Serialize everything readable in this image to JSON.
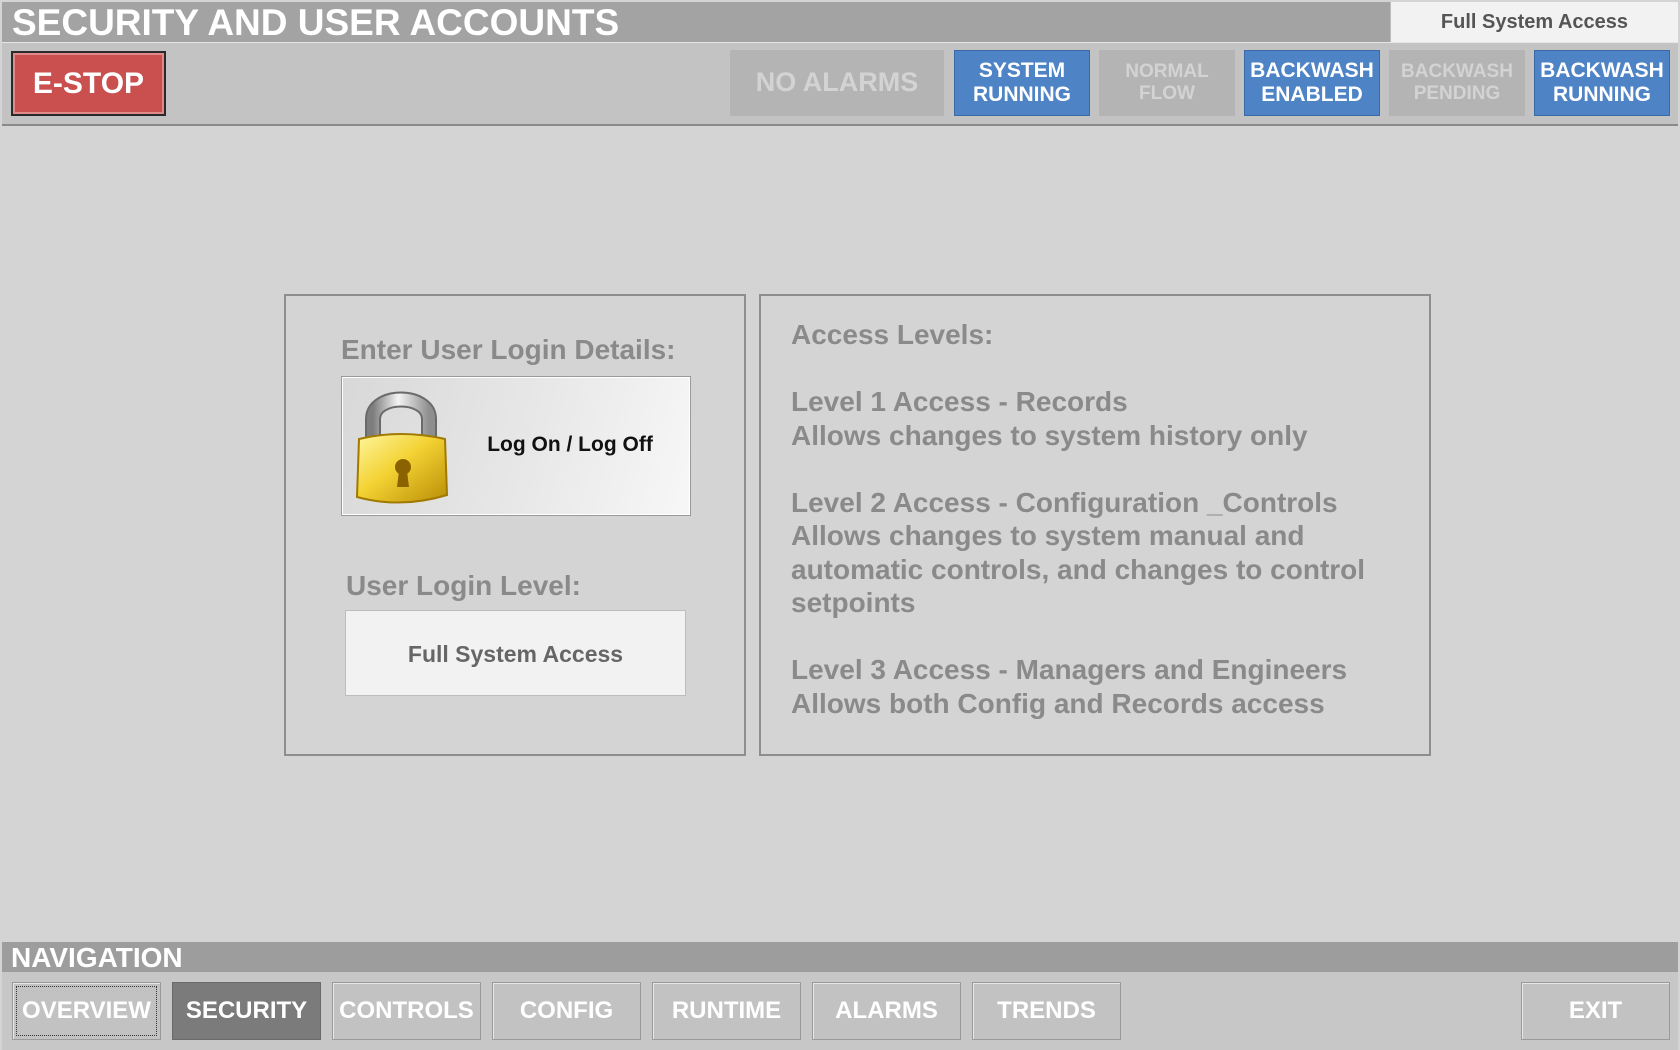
{
  "header": {
    "title": "SECURITY AND USER ACCOUNTS",
    "access_level": "Full System Access"
  },
  "status_bar": {
    "estop_label": "E-STOP",
    "indicators": [
      {
        "label": "NO ALARMS",
        "state": "inactive"
      },
      {
        "label": "SYSTEM\nRUNNING",
        "state": "active"
      },
      {
        "label": "NORMAL\nFLOW",
        "state": "inactive"
      },
      {
        "label": "BACKWASH\nENABLED",
        "state": "active"
      },
      {
        "label": "BACKWASH\nPENDING",
        "state": "inactive"
      },
      {
        "label": "BACKWASH\nRUNNING",
        "state": "active"
      }
    ]
  },
  "login": {
    "heading": "Enter User Login Details:",
    "button_label": "Log On / Log Off",
    "button_icon": "padlock-icon",
    "level_heading": "User Login Level:",
    "level_value": "Full System Access"
  },
  "access_levels": {
    "heading": "Access Levels:",
    "levels": [
      {
        "title": "Level 1 Access - Records",
        "description": "Allows changes to system history only"
      },
      {
        "title": "Level 2 Access - Configuration _Controls",
        "description": "Allows changes to system manual and automatic controls, and changes to control setpoints"
      },
      {
        "title": "Level 3 Access - Managers and Engineers",
        "description": "Allows both Config and Records access"
      }
    ]
  },
  "navigation": {
    "heading": "NAVIGATION",
    "buttons": [
      "OVERVIEW",
      "SECURITY",
      "CONTROLS",
      "CONFIG",
      "RUNTIME",
      "ALARMS",
      "TRENDS"
    ],
    "current": "SECURITY",
    "exit_label": "EXIT"
  },
  "colors": {
    "estop": "#c9504f",
    "active_indicator": "#4e83c6",
    "inactive_indicator": "#b4b4b4",
    "current_nav": "#7b7b7b",
    "background": "#d4d4d4"
  }
}
